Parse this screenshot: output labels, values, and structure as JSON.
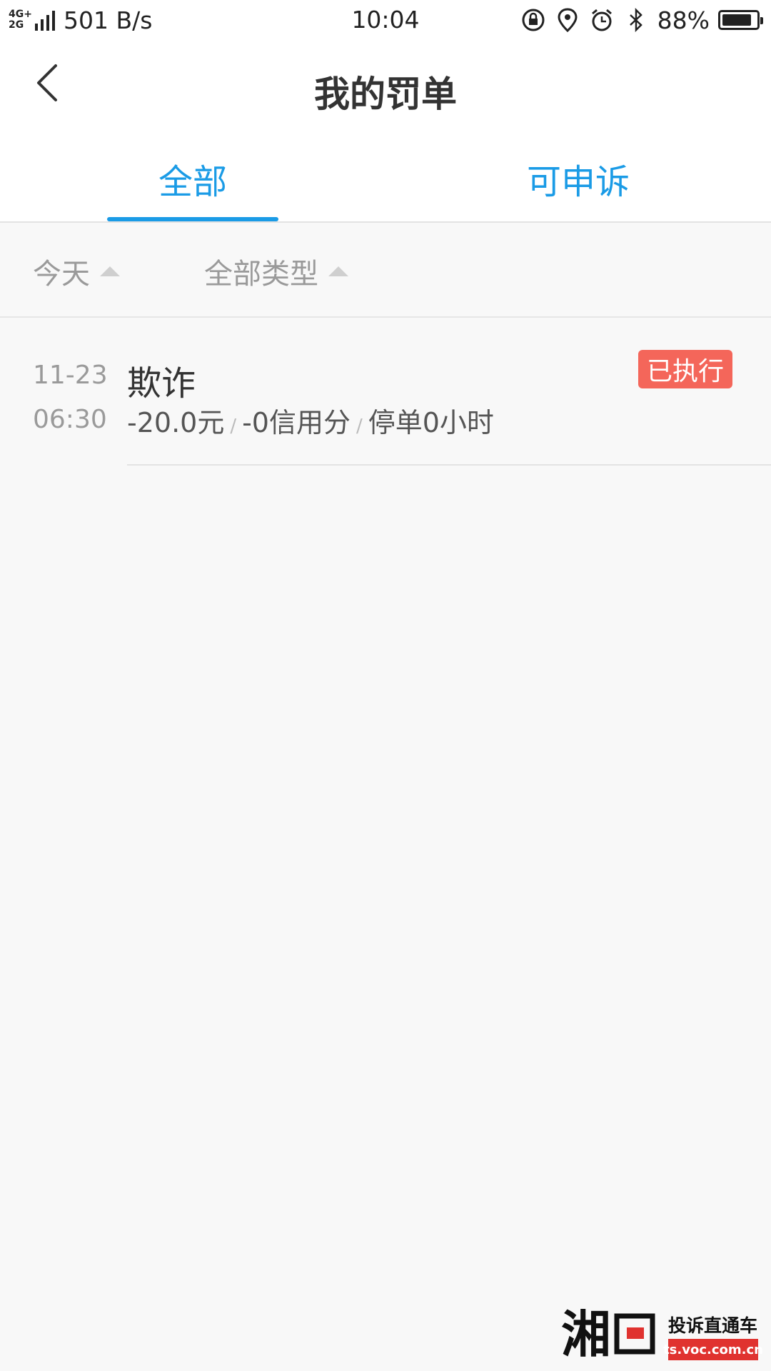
{
  "status_bar": {
    "network_top": "4G+",
    "network_bottom": "2G",
    "speed": "501 B/s",
    "time": "10:04",
    "battery": "88%",
    "battery_level": 0.88,
    "icons": [
      "screen-lock-rotation-icon",
      "location-icon",
      "alarm-icon",
      "bluetooth-icon",
      "battery-icon"
    ]
  },
  "header": {
    "title": "我的罚单"
  },
  "tabs": [
    {
      "label": "全部",
      "active": true
    },
    {
      "label": "可申诉",
      "active": false
    }
  ],
  "filters": {
    "date": "今天",
    "type": "全部类型"
  },
  "records": [
    {
      "date": "11-23",
      "time": "06:30",
      "title": "欺诈",
      "amount": "-20.0元",
      "credit": "-0信用分",
      "suspension": "停单0小时",
      "separator": "/",
      "status": "已执行"
    }
  ],
  "colors": {
    "accent": "#1a9be6",
    "badge": "#f4665a",
    "background": "#f8f8f8"
  },
  "watermark": {
    "logo_text": "湘问",
    "slogan": "投诉直通车",
    "url": "ts.voc.com.cn"
  }
}
